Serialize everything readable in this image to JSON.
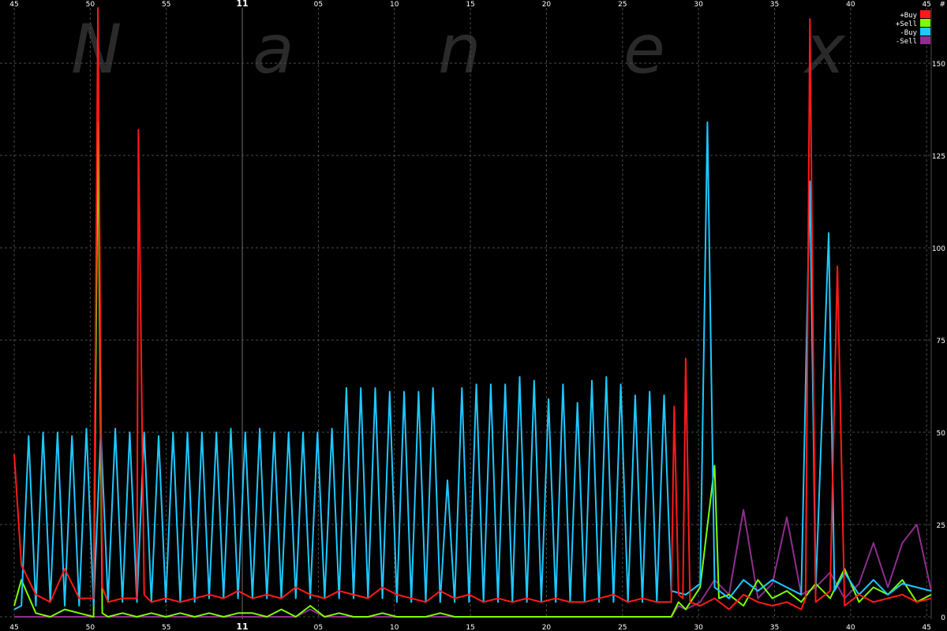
{
  "watermark": [
    "N",
    "a",
    "n",
    "e",
    "x"
  ],
  "chart_data": {
    "type": "line",
    "x_ticks_top": [
      "45",
      "50",
      "55",
      "11",
      "05",
      "10",
      "15",
      "20",
      "25",
      "30",
      "35",
      "40",
      "45"
    ],
    "x_ticks_bottom": [
      "45",
      "50",
      "55",
      "11",
      "05",
      "10",
      "15",
      "20",
      "25",
      "30",
      "35",
      "40",
      "45"
    ],
    "y_ticks": [
      {
        "value": 0,
        "label": "0"
      },
      {
        "value": 25,
        "label": "25"
      },
      {
        "value": 50,
        "label": "50"
      },
      {
        "value": 75,
        "label": "75"
      },
      {
        "value": 100,
        "label": "100"
      },
      {
        "value": 125,
        "label": "125"
      },
      {
        "value": 150,
        "label": "150"
      }
    ],
    "y_unit_label": "#",
    "ylim": [
      0,
      165
    ],
    "xlim": [
      44.5,
      108
    ],
    "grid": true,
    "legend_position": "top-right",
    "series": [
      {
        "name": "+Buy",
        "color": "#ff1a1a",
        "points": [
          [
            44.5,
            44
          ],
          [
            45,
            14
          ],
          [
            46,
            6
          ],
          [
            47,
            4
          ],
          [
            48,
            13
          ],
          [
            49,
            5
          ],
          [
            50,
            5
          ],
          [
            50.3,
            165
          ],
          [
            50.6,
            8
          ],
          [
            51,
            4
          ],
          [
            52,
            5
          ],
          [
            53,
            5
          ],
          [
            53.1,
            132
          ],
          [
            53.5,
            6
          ],
          [
            54,
            4
          ],
          [
            55,
            5
          ],
          [
            56,
            4
          ],
          [
            57,
            5
          ],
          [
            58,
            6
          ],
          [
            59,
            5
          ],
          [
            60,
            7
          ],
          [
            61,
            5
          ],
          [
            62,
            6
          ],
          [
            63,
            5
          ],
          [
            64,
            8
          ],
          [
            65,
            6
          ],
          [
            66,
            5
          ],
          [
            67,
            7
          ],
          [
            68,
            6
          ],
          [
            69,
            5
          ],
          [
            70,
            8
          ],
          [
            71,
            6
          ],
          [
            72,
            5
          ],
          [
            73,
            4
          ],
          [
            74,
            7
          ],
          [
            75,
            5
          ],
          [
            76,
            6
          ],
          [
            77,
            4
          ],
          [
            78,
            5
          ],
          [
            79,
            4
          ],
          [
            80,
            5
          ],
          [
            81,
            4
          ],
          [
            82,
            5
          ],
          [
            83,
            4
          ],
          [
            84,
            4
          ],
          [
            85,
            5
          ],
          [
            86,
            6
          ],
          [
            87,
            4
          ],
          [
            88,
            5
          ],
          [
            89,
            4
          ],
          [
            90,
            4
          ],
          [
            90.2,
            57
          ],
          [
            90.5,
            6
          ],
          [
            90.8,
            5
          ],
          [
            91,
            70
          ],
          [
            91.3,
            4
          ],
          [
            92,
            3
          ],
          [
            93,
            5
          ],
          [
            94,
            2
          ],
          [
            95,
            6
          ],
          [
            96,
            4
          ],
          [
            97,
            3
          ],
          [
            98,
            4
          ],
          [
            99,
            2
          ],
          [
            99.3,
            5
          ],
          [
            99.6,
            162
          ],
          [
            100,
            4
          ],
          [
            101,
            7
          ],
          [
            101.5,
            95
          ],
          [
            102,
            3
          ],
          [
            103,
            6
          ],
          [
            104,
            4
          ],
          [
            105,
            5
          ],
          [
            106,
            6
          ],
          [
            107,
            4
          ],
          [
            108,
            5
          ]
        ]
      },
      {
        "name": "+Sell",
        "color": "#7cfc00",
        "points": [
          [
            44.5,
            3
          ],
          [
            45,
            10
          ],
          [
            46,
            1
          ],
          [
            47,
            0
          ],
          [
            48,
            2
          ],
          [
            49,
            1
          ],
          [
            50,
            0
          ],
          [
            50.3,
            134
          ],
          [
            50.6,
            1
          ],
          [
            51,
            0
          ],
          [
            52,
            1
          ],
          [
            53,
            0
          ],
          [
            54,
            1
          ],
          [
            55,
            0
          ],
          [
            56,
            1
          ],
          [
            57,
            0
          ],
          [
            58,
            1
          ],
          [
            59,
            0
          ],
          [
            60,
            1
          ],
          [
            61,
            1
          ],
          [
            62,
            0
          ],
          [
            63,
            2
          ],
          [
            64,
            0
          ],
          [
            65,
            3
          ],
          [
            66,
            0
          ],
          [
            67,
            1
          ],
          [
            68,
            0
          ],
          [
            69,
            0
          ],
          [
            70,
            1
          ],
          [
            71,
            0
          ],
          [
            72,
            0
          ],
          [
            73,
            0
          ],
          [
            74,
            1
          ],
          [
            75,
            0
          ],
          [
            76,
            0
          ],
          [
            77,
            0
          ],
          [
            78,
            0
          ],
          [
            79,
            0
          ],
          [
            80,
            0
          ],
          [
            81,
            0
          ],
          [
            82,
            0
          ],
          [
            83,
            0
          ],
          [
            84,
            0
          ],
          [
            85,
            0
          ],
          [
            86,
            0
          ],
          [
            87,
            0
          ],
          [
            88,
            0
          ],
          [
            89,
            0
          ],
          [
            90,
            0
          ],
          [
            90.5,
            4
          ],
          [
            91,
            2
          ],
          [
            92,
            8
          ],
          [
            93,
            41
          ],
          [
            93.3,
            5
          ],
          [
            94,
            6
          ],
          [
            95,
            3
          ],
          [
            96,
            10
          ],
          [
            97,
            5
          ],
          [
            98,
            7
          ],
          [
            99,
            4
          ],
          [
            100,
            9
          ],
          [
            101,
            5
          ],
          [
            102,
            13
          ],
          [
            103,
            4
          ],
          [
            104,
            8
          ],
          [
            105,
            6
          ],
          [
            106,
            10
          ],
          [
            107,
            4
          ],
          [
            108,
            6
          ]
        ]
      },
      {
        "name": "-Buy",
        "color": "#1ec8ff",
        "points": [
          [
            44.5,
            2
          ],
          [
            45,
            3
          ],
          [
            45.5,
            49
          ],
          [
            46,
            3
          ],
          [
            46.5,
            50
          ],
          [
            47,
            4
          ],
          [
            47.5,
            50
          ],
          [
            48,
            3
          ],
          [
            48.5,
            49
          ],
          [
            49,
            3
          ],
          [
            49.5,
            51
          ],
          [
            50,
            3
          ],
          [
            50.5,
            50
          ],
          [
            51,
            4
          ],
          [
            51.5,
            51
          ],
          [
            52,
            4
          ],
          [
            52.5,
            50
          ],
          [
            53,
            4
          ],
          [
            53.5,
            50
          ],
          [
            54,
            4
          ],
          [
            54.5,
            49
          ],
          [
            55,
            4
          ],
          [
            55.5,
            50
          ],
          [
            56,
            4
          ],
          [
            56.5,
            50
          ],
          [
            57,
            4
          ],
          [
            57.5,
            50
          ],
          [
            58,
            5
          ],
          [
            58.5,
            50
          ],
          [
            59,
            5
          ],
          [
            59.5,
            51
          ],
          [
            60,
            5
          ],
          [
            60.5,
            50
          ],
          [
            61,
            5
          ],
          [
            61.5,
            51
          ],
          [
            62,
            5
          ],
          [
            62.5,
            50
          ],
          [
            63,
            5
          ],
          [
            63.5,
            50
          ],
          [
            64,
            5
          ],
          [
            64.5,
            50
          ],
          [
            65,
            5
          ],
          [
            65.5,
            50
          ],
          [
            66,
            5
          ],
          [
            66.5,
            51
          ],
          [
            67,
            5
          ],
          [
            67.5,
            62
          ],
          [
            68,
            5
          ],
          [
            68.5,
            62
          ],
          [
            69,
            5
          ],
          [
            69.5,
            62
          ],
          [
            70,
            5
          ],
          [
            70.5,
            61
          ],
          [
            71,
            4
          ],
          [
            71.5,
            61
          ],
          [
            72,
            4
          ],
          [
            72.5,
            61
          ],
          [
            73,
            4
          ],
          [
            73.5,
            62
          ],
          [
            74,
            4
          ],
          [
            74.5,
            37
          ],
          [
            75,
            4
          ],
          [
            75.5,
            62
          ],
          [
            76,
            4
          ],
          [
            76.5,
            63
          ],
          [
            77,
            4
          ],
          [
            77.5,
            63
          ],
          [
            78,
            4
          ],
          [
            78.5,
            63
          ],
          [
            79,
            4
          ],
          [
            79.5,
            65
          ],
          [
            80,
            4
          ],
          [
            80.5,
            64
          ],
          [
            81,
            4
          ],
          [
            81.5,
            59
          ],
          [
            82,
            4
          ],
          [
            82.5,
            63
          ],
          [
            83,
            4
          ],
          [
            83.5,
            58
          ],
          [
            84,
            4
          ],
          [
            84.5,
            64
          ],
          [
            85,
            4
          ],
          [
            85.5,
            65
          ],
          [
            86,
            4
          ],
          [
            86.5,
            63
          ],
          [
            87,
            4
          ],
          [
            87.5,
            60
          ],
          [
            88,
            4
          ],
          [
            88.5,
            61
          ],
          [
            89,
            4
          ],
          [
            89.5,
            60
          ],
          [
            90,
            7
          ],
          [
            91,
            6
          ],
          [
            92,
            9
          ],
          [
            92.5,
            134
          ],
          [
            93,
            8
          ],
          [
            94,
            5
          ],
          [
            95,
            10
          ],
          [
            96,
            7
          ],
          [
            97,
            10
          ],
          [
            98,
            8
          ],
          [
            99,
            6
          ],
          [
            99.6,
            118
          ],
          [
            100,
            7
          ],
          [
            100.9,
            104
          ],
          [
            101.3,
            7
          ],
          [
            102,
            12
          ],
          [
            103,
            6
          ],
          [
            104,
            10
          ],
          [
            105,
            6
          ],
          [
            106,
            9
          ],
          [
            107,
            8
          ],
          [
            108,
            7
          ]
        ]
      },
      {
        "name": "-Sell",
        "color": "#8e2e8e",
        "points": [
          [
            44.5,
            0
          ],
          [
            45,
            0
          ],
          [
            50,
            0
          ],
          [
            55,
            0
          ],
          [
            60,
            0
          ],
          [
            64,
            0
          ],
          [
            65,
            2
          ],
          [
            66,
            0
          ],
          [
            70,
            0
          ],
          [
            75,
            0
          ],
          [
            80,
            0
          ],
          [
            85,
            0
          ],
          [
            90,
            0
          ],
          [
            90.5,
            3
          ],
          [
            91,
            2
          ],
          [
            92,
            4
          ],
          [
            93,
            10
          ],
          [
            94,
            6
          ],
          [
            95,
            29
          ],
          [
            96,
            5
          ],
          [
            97,
            9
          ],
          [
            98,
            27
          ],
          [
            99,
            6
          ],
          [
            100,
            8
          ],
          [
            101,
            12
          ],
          [
            102,
            5
          ],
          [
            103,
            9
          ],
          [
            104,
            20
          ],
          [
            105,
            8
          ],
          [
            106,
            20
          ],
          [
            107,
            25
          ],
          [
            108,
            7
          ]
        ]
      }
    ]
  }
}
